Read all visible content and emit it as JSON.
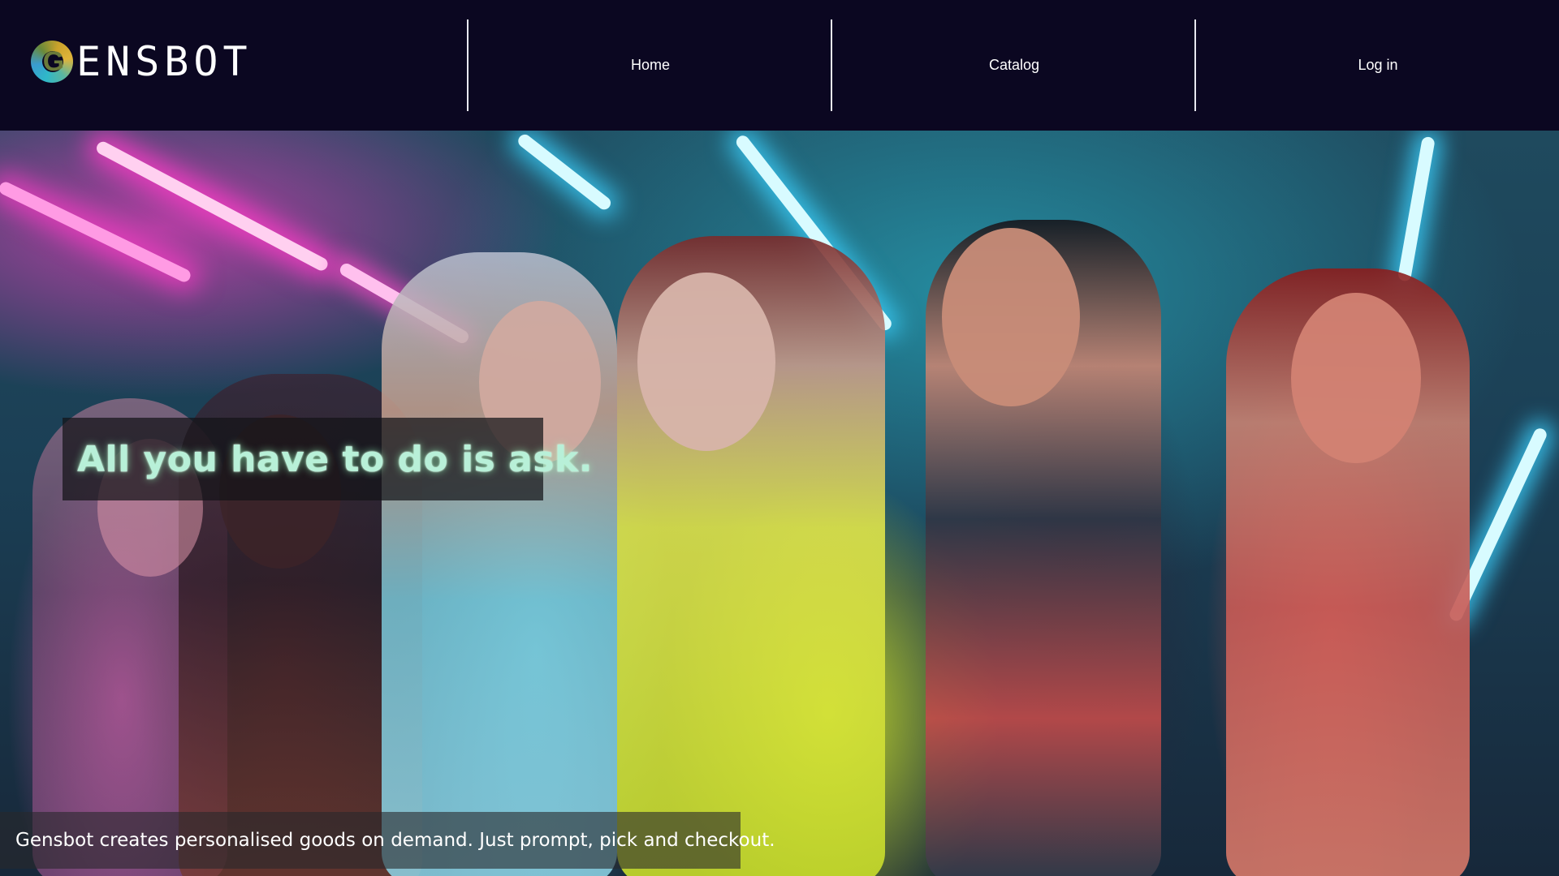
{
  "brand": {
    "logo_letter": "G",
    "name": "ENSBOT"
  },
  "nav": {
    "items": [
      {
        "label": "Home"
      },
      {
        "label": "Catalog"
      },
      {
        "label": "Log in"
      }
    ]
  },
  "hero": {
    "title": "All you have to do is ask.",
    "subtitle": "Gensbot creates personalised goods on demand. Just prompt, pick and checkout."
  },
  "colors": {
    "header_bg": "#0b0721",
    "title_glow": "#b8f0d8"
  }
}
